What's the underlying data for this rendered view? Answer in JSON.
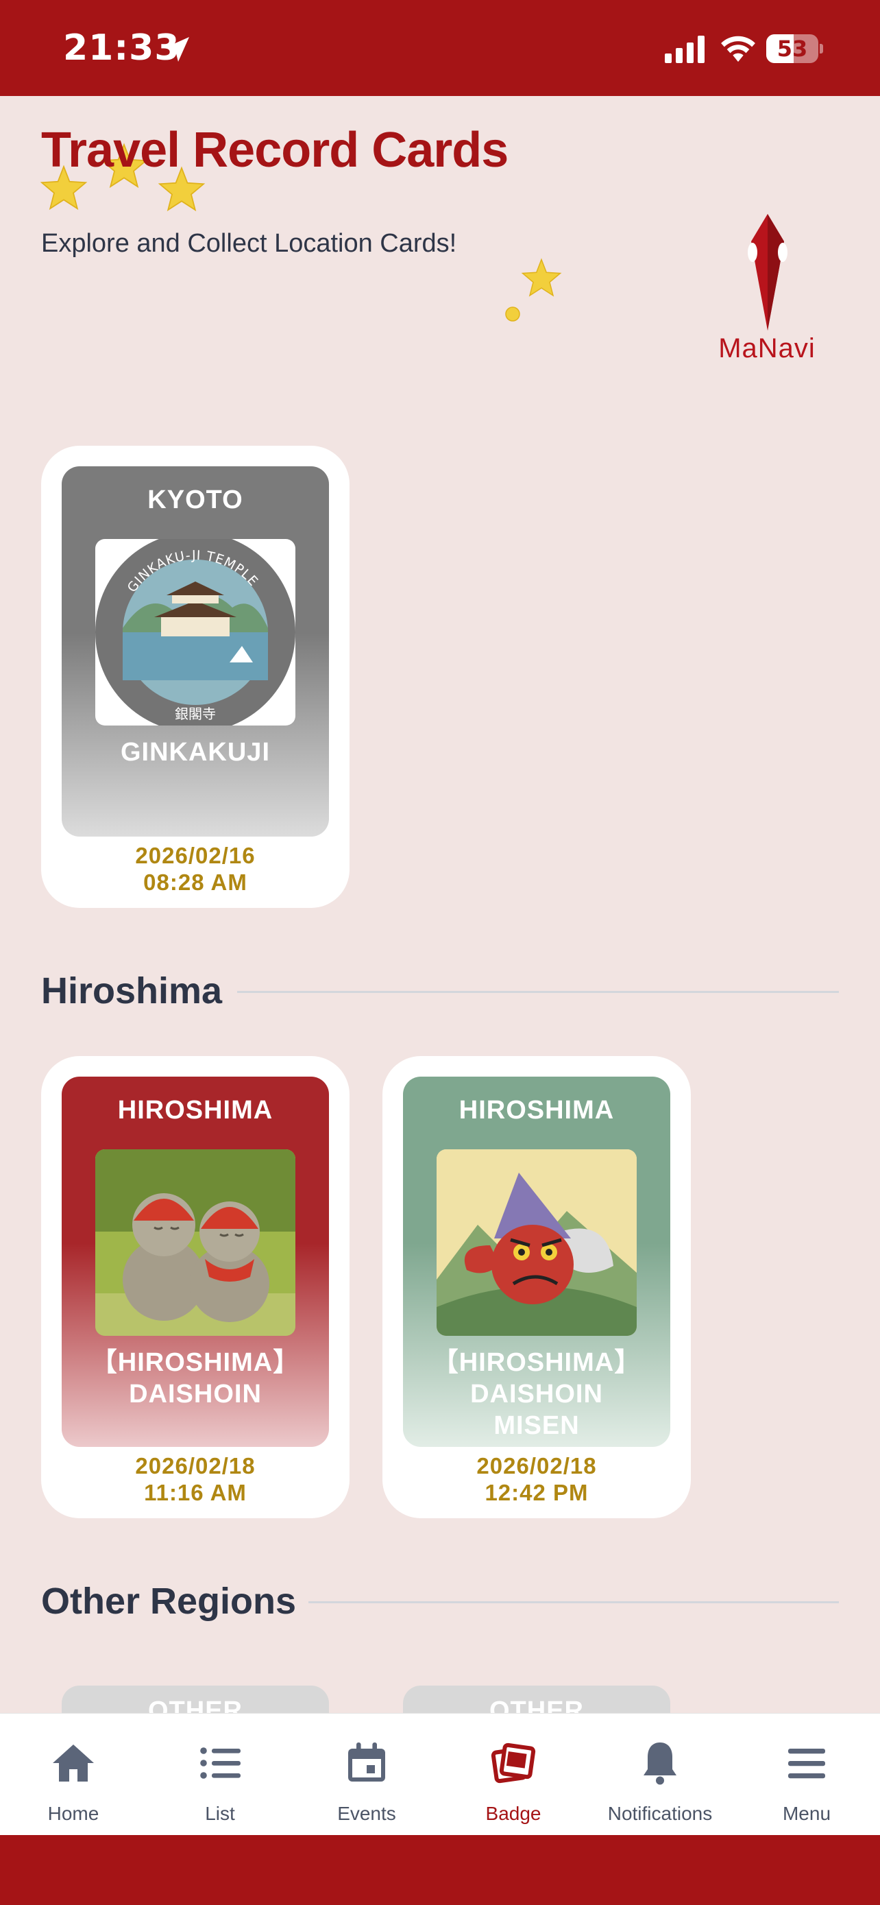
{
  "status_bar": {
    "time": "21:33",
    "battery": "53",
    "battery_level": 0.53
  },
  "header": {
    "title": "Travel Record Cards",
    "subtitle": "Explore and Collect Location Cards!",
    "logo_text": "MaNavi"
  },
  "cards_top": [
    {
      "region": "KYOTO",
      "image_caption_top": "GINKAKU-JI TEMPLE",
      "image_caption_bottom": "銀閣寺",
      "name": "GINKAKUJI",
      "date": "2026/02/16",
      "time": "08:28 AM",
      "color": "#7b7b7b"
    }
  ],
  "sections": [
    {
      "title": "Hiroshima",
      "cards": [
        {
          "region": "HIROSHIMA",
          "name_line1": "【HIROSHIMA】",
          "name_line2": "DAISHOIN",
          "date": "2026/02/18",
          "time": "11:16 AM",
          "color": "#a8262a"
        },
        {
          "region": "HIROSHIMA",
          "name_line1": "【HIROSHIMA】",
          "name_line2": "DAISHOIN",
          "name_line3": "MISEN",
          "date": "2026/02/18",
          "time": "12:42 PM",
          "color": "#7fa78f"
        }
      ]
    },
    {
      "title": "Other Regions",
      "cards": [
        {
          "region": "OTHER"
        },
        {
          "region": "OTHER"
        }
      ]
    }
  ],
  "tabbar": {
    "items": [
      {
        "label": "Home",
        "icon": "home-icon"
      },
      {
        "label": "List",
        "icon": "list-icon"
      },
      {
        "label": "Events",
        "icon": "calendar-icon"
      },
      {
        "label": "Badge",
        "icon": "badge-cards-icon",
        "active": true
      },
      {
        "label": "Notifications",
        "icon": "bell-icon"
      },
      {
        "label": "Menu",
        "icon": "hamburger-menu-icon"
      }
    ]
  },
  "colors": {
    "brand_red": "#a51416",
    "date_gold": "#b08712",
    "heading_dark": "#2e3547",
    "page_bg": "#f2e4e2"
  }
}
